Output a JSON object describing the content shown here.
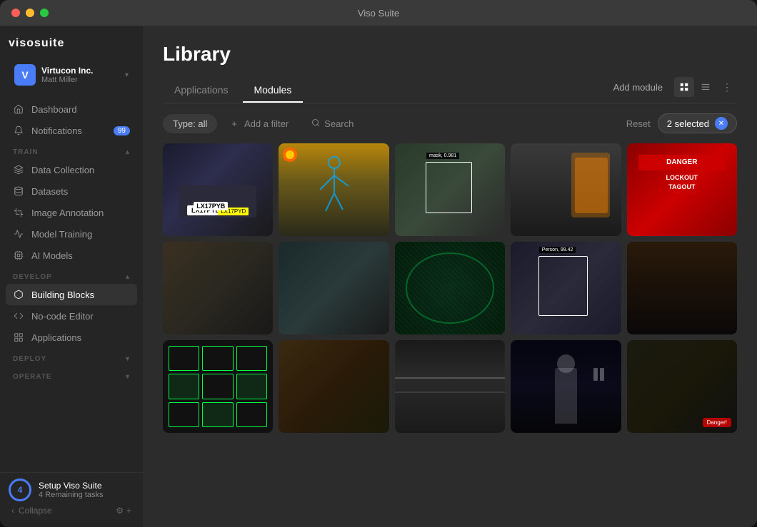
{
  "window": {
    "title": "Viso Suite"
  },
  "sidebar": {
    "logo": "visosuite",
    "org": {
      "avatar_letter": "V",
      "name": "Virtucon Inc.",
      "user": "Matt Miller"
    },
    "top_nav": [
      {
        "id": "dashboard",
        "label": "Dashboard",
        "icon": "home"
      },
      {
        "id": "notifications",
        "label": "Notifications",
        "icon": "bell",
        "badge": "99"
      }
    ],
    "sections": [
      {
        "id": "train",
        "label": "TRAIN",
        "items": [
          {
            "id": "data-collection",
            "label": "Data Collection",
            "icon": "layers"
          },
          {
            "id": "datasets",
            "label": "Datasets",
            "icon": "database"
          },
          {
            "id": "image-annotation",
            "label": "Image Annotation",
            "icon": "crop"
          },
          {
            "id": "model-training",
            "label": "Model Training",
            "icon": "activity"
          },
          {
            "id": "ai-models",
            "label": "AI Models",
            "icon": "cpu"
          }
        ]
      },
      {
        "id": "develop",
        "label": "DEVELOP",
        "items": [
          {
            "id": "building-blocks",
            "label": "Building Blocks",
            "icon": "box",
            "active": true
          },
          {
            "id": "no-code-editor",
            "label": "No-code Editor",
            "icon": "code"
          },
          {
            "id": "applications",
            "label": "Applications",
            "icon": "grid"
          }
        ]
      },
      {
        "id": "deploy",
        "label": "DEPLOY",
        "items": []
      },
      {
        "id": "operate",
        "label": "OPERATE",
        "items": []
      }
    ],
    "setup": {
      "number": "4",
      "title": "Setup Viso Suite",
      "subtitle": "4 Remaining tasks"
    },
    "collapse_label": "Collapse"
  },
  "main": {
    "page_title": "Library",
    "tabs": [
      {
        "id": "applications",
        "label": "Applications",
        "active": false
      },
      {
        "id": "modules",
        "label": "Modules",
        "active": true
      }
    ],
    "add_module_label": "Add module",
    "filter": {
      "type_label": "Type: all",
      "add_filter_label": "+ Add a filter",
      "search_label": "Search",
      "reset_label": "Reset",
      "selected_label": "2 selected"
    },
    "grid": {
      "cells": [
        {
          "id": "cell-1",
          "type": "img-car",
          "overlay": "LX17PYB",
          "selected": false
        },
        {
          "id": "cell-2",
          "type": "img-worker",
          "selected": false
        },
        {
          "id": "cell-3",
          "type": "img-person-mask",
          "overlay_text": "mask, 0.981",
          "selected": false
        },
        {
          "id": "cell-4",
          "type": "img-safety",
          "selected": false
        },
        {
          "id": "cell-5",
          "type": "img-danger",
          "overlay_br": "DANGER LOCKOUT",
          "selected": false
        },
        {
          "id": "cell-6",
          "type": "img-meeting",
          "selected": false
        },
        {
          "id": "cell-7",
          "type": "img-worker2",
          "selected": false
        },
        {
          "id": "cell-8",
          "type": "img-globe",
          "selected": false
        },
        {
          "id": "cell-9",
          "type": "img-person-detect",
          "overlay_text": "Person, 99.42",
          "selected": false
        },
        {
          "id": "cell-10",
          "type": "img-warehouse",
          "selected": false
        },
        {
          "id": "cell-11",
          "type": "img-parking",
          "selected": false
        },
        {
          "id": "cell-12",
          "type": "img-office",
          "selected": false
        },
        {
          "id": "cell-13",
          "type": "img-traffic",
          "selected": false
        },
        {
          "id": "cell-14",
          "type": "img-person-walk",
          "selected": false
        },
        {
          "id": "cell-15",
          "type": "img-train",
          "overlay_br": "Danger!",
          "selected": false
        }
      ]
    }
  }
}
